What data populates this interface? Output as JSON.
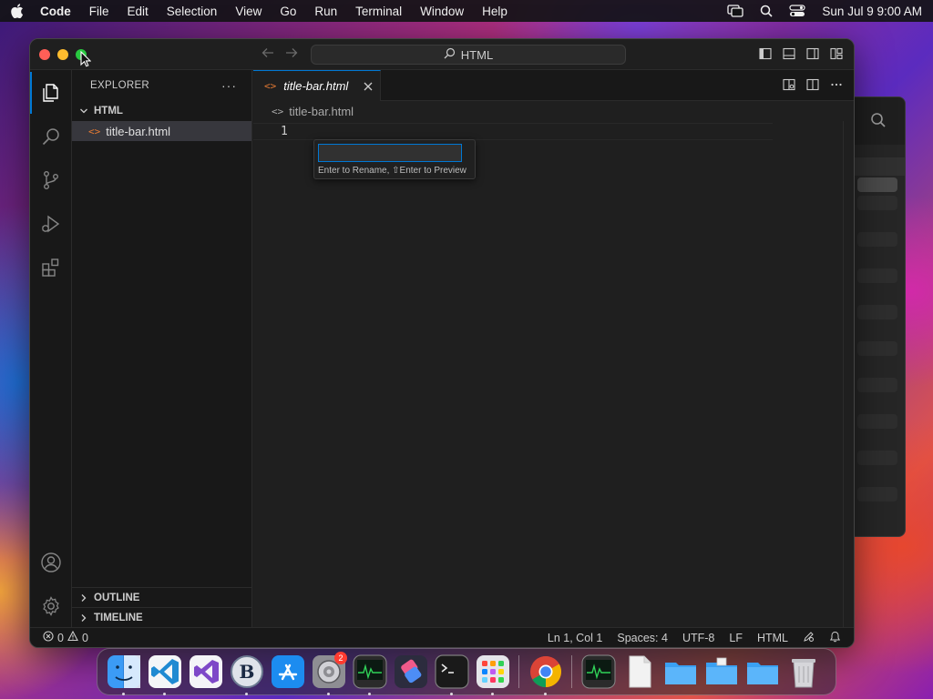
{
  "menubar": {
    "app_name": "Code",
    "items": [
      "File",
      "Edit",
      "Selection",
      "View",
      "Go",
      "Run",
      "Terminal",
      "Window",
      "Help"
    ],
    "clock": "Sun Jul 9  9:00 AM"
  },
  "window": {
    "command_center": "HTML",
    "sidebar": {
      "title": "EXPLORER",
      "more": "···",
      "folder": "HTML",
      "file": "title-bar.html",
      "outline": "OUTLINE",
      "timeline": "TIMELINE"
    },
    "editor": {
      "tab_label": "title-bar.html",
      "breadcrumb": "title-bar.html",
      "line_number": "1",
      "rename_value": "",
      "rename_hint": "Enter to Rename, ⇧Enter to Preview"
    },
    "statusbar": {
      "errors": "0",
      "warnings": "0",
      "position": "Ln 1, Col 1",
      "spaces": "Spaces: 4",
      "encoding": "UTF-8",
      "eol": "LF",
      "language": "HTML"
    }
  },
  "colors": {
    "accent": "#0078d4",
    "html_icon": "#e37933",
    "close": "#ff5f57",
    "minimize": "#febc2e",
    "maximize": "#28c840"
  },
  "dock": {
    "apps": [
      "finder",
      "vscode",
      "visual-studio",
      "bbedit",
      "app-store",
      "system-settings",
      "activity-monitor",
      "shortcuts",
      "terminal",
      "launchpad",
      "chrome",
      "activity-monitor-2",
      "document",
      "folder-1",
      "folder-2",
      "folder-3",
      "trash"
    ],
    "settings_badge": "2"
  }
}
